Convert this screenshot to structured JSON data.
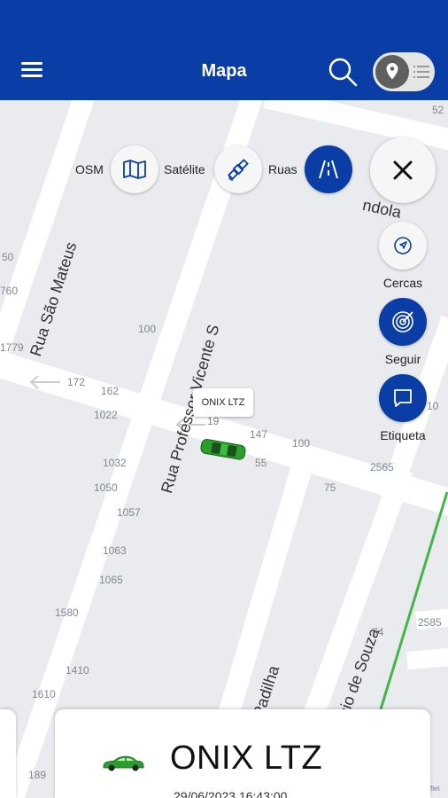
{
  "header": {
    "title": "Mapa",
    "background": "#0a3ea6"
  },
  "map": {
    "street_labels": {
      "sao_mateus": "Rua São Mateus",
      "vicente_s": "Rua Professor Vicente S",
      "vicente_padilha": "Rua Vicente Padilha",
      "jose_felicio": "Rua José Felício de Souza",
      "top_right": "ndola"
    },
    "numbers": [
      "52",
      "50",
      "760",
      "1779",
      "100",
      "172",
      "162",
      "1022",
      "147",
      "100",
      "55",
      "2565",
      "75",
      "1032",
      "1050",
      "1057",
      "1063",
      "1065",
      "1580",
      "1410",
      "1610",
      "189",
      "74",
      "2585",
      "10",
      "19"
    ],
    "layers": {
      "osm": "OSM",
      "satellite": "Satélite",
      "streets": "Ruas",
      "active": "Ruas"
    },
    "actions": {
      "fences": "Cercas",
      "follow": "Seguir",
      "label": "Etiqueta"
    },
    "vehicle_tag": "ONIX LTZ",
    "vehicle_color": "#2a9d2a",
    "route_color": "#43b54a",
    "attribution": "flet"
  },
  "sheet": {
    "vehicle_name": "ONIX LTZ",
    "datetime": "29/06/2023 16:43:00"
  }
}
